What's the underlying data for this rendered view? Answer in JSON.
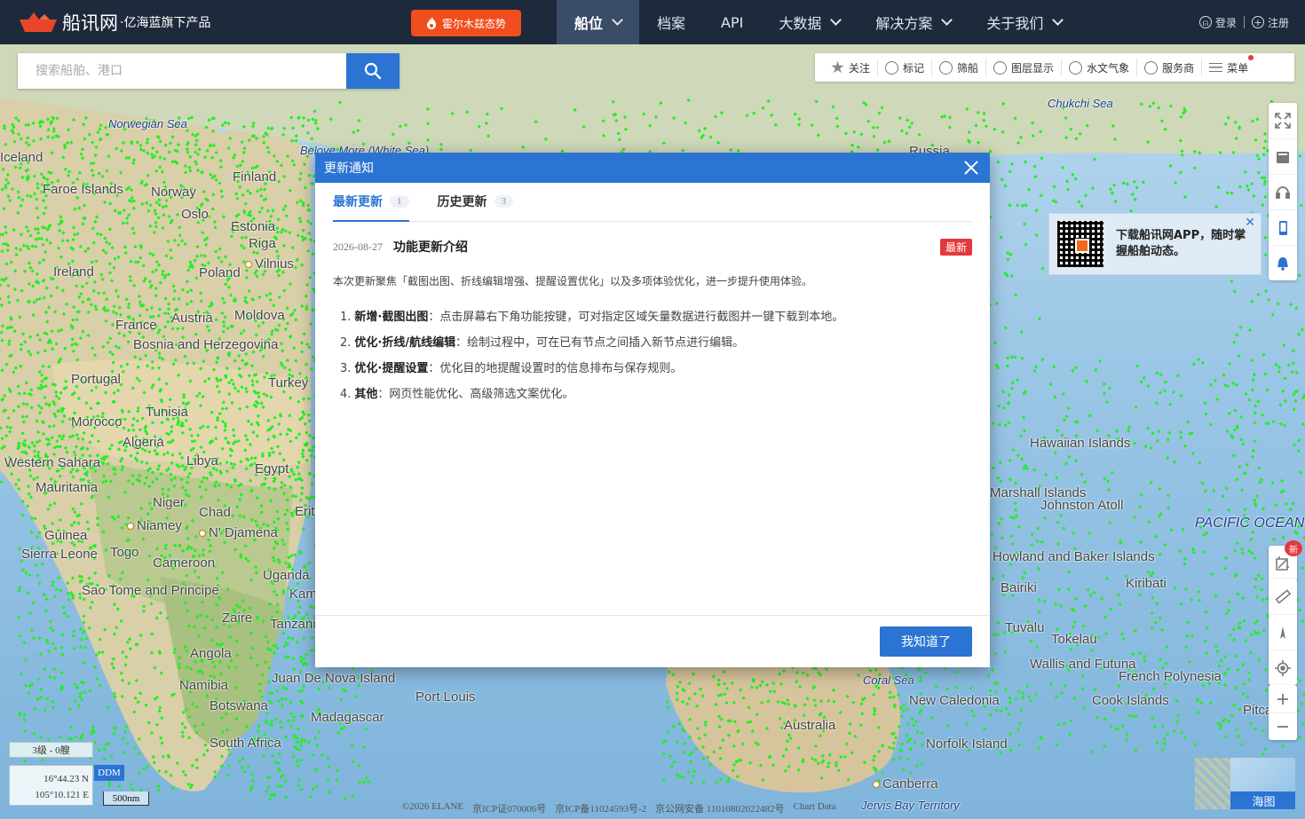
{
  "header": {
    "logo_text": "船讯网",
    "logo_sub": "·亿海蓝旗下产品",
    "hot_button": "霍尔木兹态势",
    "nav": [
      {
        "label": "船位",
        "has_menu": true,
        "active": true
      },
      {
        "label": "档案",
        "has_menu": false
      },
      {
        "label": "API",
        "has_menu": false
      },
      {
        "label": "大数据",
        "has_menu": true
      },
      {
        "label": "解决方案",
        "has_menu": true
      },
      {
        "label": "关于我们",
        "has_menu": true
      }
    ],
    "login": "登录",
    "register": "注册"
  },
  "search": {
    "placeholder": "搜索船舶、港口"
  },
  "toolbar": {
    "items": [
      {
        "label": "关注",
        "icon": "star-icon"
      },
      {
        "label": "标记",
        "icon": "tag-icon"
      },
      {
        "label": "筛船",
        "icon": "filter-icon"
      },
      {
        "label": "图层显示",
        "icon": "layers-icon"
      },
      {
        "label": "水文气象",
        "icon": "weather-icon"
      },
      {
        "label": "服务商",
        "icon": "service-icon"
      },
      {
        "label": "菜单",
        "icon": "menu-icon",
        "dot": true
      }
    ]
  },
  "map": {
    "labels": [
      {
        "text": "Norwegian Sea",
        "type": "sea"
      },
      {
        "text": "Beloye More (White Sea)",
        "type": "sea"
      },
      {
        "text": "Chukchi Sea",
        "type": "sea"
      },
      {
        "text": "Russia",
        "type": "land"
      },
      {
        "text": "Iceland",
        "type": "land"
      },
      {
        "text": "Faroe Islands",
        "type": "land"
      },
      {
        "text": "Norway",
        "type": "land"
      },
      {
        "text": "Finland",
        "type": "land"
      },
      {
        "text": "Oslo",
        "type": "land"
      },
      {
        "text": "Estonia",
        "type": "land"
      },
      {
        "text": "Riga",
        "type": "land"
      },
      {
        "text": "Vilnius",
        "type": "city"
      },
      {
        "text": "Poland",
        "type": "land"
      },
      {
        "text": "Ireland",
        "type": "land"
      },
      {
        "text": "Austria",
        "type": "land"
      },
      {
        "text": "Moldova",
        "type": "land"
      },
      {
        "text": "France",
        "type": "land"
      },
      {
        "text": "Bosnia and Herzegovina",
        "type": "land"
      },
      {
        "text": "Portugal",
        "type": "land"
      },
      {
        "text": "Turkey",
        "type": "land"
      },
      {
        "text": "Tunisia",
        "type": "land"
      },
      {
        "text": "Morocco",
        "type": "land"
      },
      {
        "text": "Algeria",
        "type": "land"
      },
      {
        "text": "Libya",
        "type": "land"
      },
      {
        "text": "Egypt",
        "type": "land"
      },
      {
        "text": "Western Sahara",
        "type": "land"
      },
      {
        "text": "Mauritania",
        "type": "land"
      },
      {
        "text": "Niger",
        "type": "land"
      },
      {
        "text": "Chad",
        "type": "land"
      },
      {
        "text": "Eritrea",
        "type": "land"
      },
      {
        "text": "Niamey",
        "type": "city"
      },
      {
        "text": "N' Djamena",
        "type": "city"
      },
      {
        "text": "Guinea",
        "type": "land"
      },
      {
        "text": "Sierra Leone",
        "type": "land"
      },
      {
        "text": "Togo",
        "type": "land"
      },
      {
        "text": "Cameroon",
        "type": "land"
      },
      {
        "text": "Uganda",
        "type": "land"
      },
      {
        "text": "Sao Tome and Principe",
        "type": "land"
      },
      {
        "text": "Kampala",
        "type": "land"
      },
      {
        "text": "Zaire",
        "type": "land"
      },
      {
        "text": "Tanzania",
        "type": "land"
      },
      {
        "text": "Angola",
        "type": "land"
      },
      {
        "text": "Namibia",
        "type": "land"
      },
      {
        "text": "Juan De Nova Island",
        "type": "land"
      },
      {
        "text": "Port Louis",
        "type": "land"
      },
      {
        "text": "Botswana",
        "type": "land"
      },
      {
        "text": "Madagascar",
        "type": "land"
      },
      {
        "text": "South Africa",
        "type": "land"
      },
      {
        "text": "Australia",
        "type": "land"
      },
      {
        "text": "Coral Sea",
        "type": "sea"
      },
      {
        "text": "New Caledonia",
        "type": "land"
      },
      {
        "text": "Norfolk Island",
        "type": "land"
      },
      {
        "text": "Canberra",
        "type": "city"
      },
      {
        "text": "Jervis Bay Territory",
        "type": "sea"
      },
      {
        "text": "PACIFIC OCEAN",
        "type": "ocean"
      },
      {
        "text": "Johnston Atoll",
        "type": "land"
      },
      {
        "text": "Howland and Baker Islands",
        "type": "land"
      },
      {
        "text": "Bairiki",
        "type": "land"
      },
      {
        "text": "Kiribati",
        "type": "land"
      },
      {
        "text": "Tuvalu",
        "type": "land"
      },
      {
        "text": "Tokelau",
        "type": "land"
      },
      {
        "text": "Wallis and Futuna",
        "type": "land"
      },
      {
        "text": "French Polynesia",
        "type": "land"
      },
      {
        "text": "Cook Islands",
        "type": "land"
      },
      {
        "text": "Pitcairn",
        "type": "land"
      },
      {
        "text": "Hawaiian Islands",
        "type": "land"
      },
      {
        "text": "Marshall Islands",
        "type": "land"
      }
    ]
  },
  "modal": {
    "title": "更新通知",
    "tabs": [
      {
        "label": "最新更新",
        "count": "1",
        "active": true
      },
      {
        "label": "历史更新",
        "count": "3",
        "active": false
      }
    ],
    "date": "2026-08-27",
    "item_title": "功能更新介绍",
    "tag": "最新",
    "intro": "本次更新聚焦「截图出图、折线编辑增强、提醒设置优化」以及多项体验优化，进一步提升使用体验。",
    "list": [
      {
        "num": "1.",
        "bold": "新增·截图出图",
        "text": "：点击屏幕右下角功能按键，可对指定区域矢量数据进行截图并一键下载到本地。"
      },
      {
        "num": "2.",
        "bold": "优化·折线/航线编辑",
        "text": "：绘制过程中，可在已有节点之间插入新节点进行编辑。"
      },
      {
        "num": "3.",
        "bold": "优化·提醒设置",
        "text": "：优化目的地提醒设置时的信息排布与保存规则。"
      },
      {
        "num": "4.",
        "bold": "其他",
        "text": "：网页性能优化、高级筛选文案优化。"
      }
    ],
    "ok_button": "我知道了"
  },
  "app_promo": {
    "text": "下载船讯网APP，随时掌握船舶动态。"
  },
  "side_tools": {
    "new_badge": "新"
  },
  "status": {
    "level": "3级 - 0艘",
    "lat": "16°44.23 N",
    "lon": "105°10.121 E",
    "ddm": "DDM",
    "scale": "500nm"
  },
  "minimap": {
    "label": "海图"
  },
  "footer": {
    "copyright": "©2026 ELANE",
    "icp1": "京ICP证070006号",
    "icp2": "京ICP备11024593号-2",
    "police": "京公网安备 11010802022482号",
    "extra": "Chart Data"
  },
  "colors": {
    "nav_bg": "#1e2a3b",
    "accent": "#2b74d4",
    "hot": "#f04e1e",
    "ship_dots": "#22ee22",
    "tag_red": "#e4393c"
  }
}
